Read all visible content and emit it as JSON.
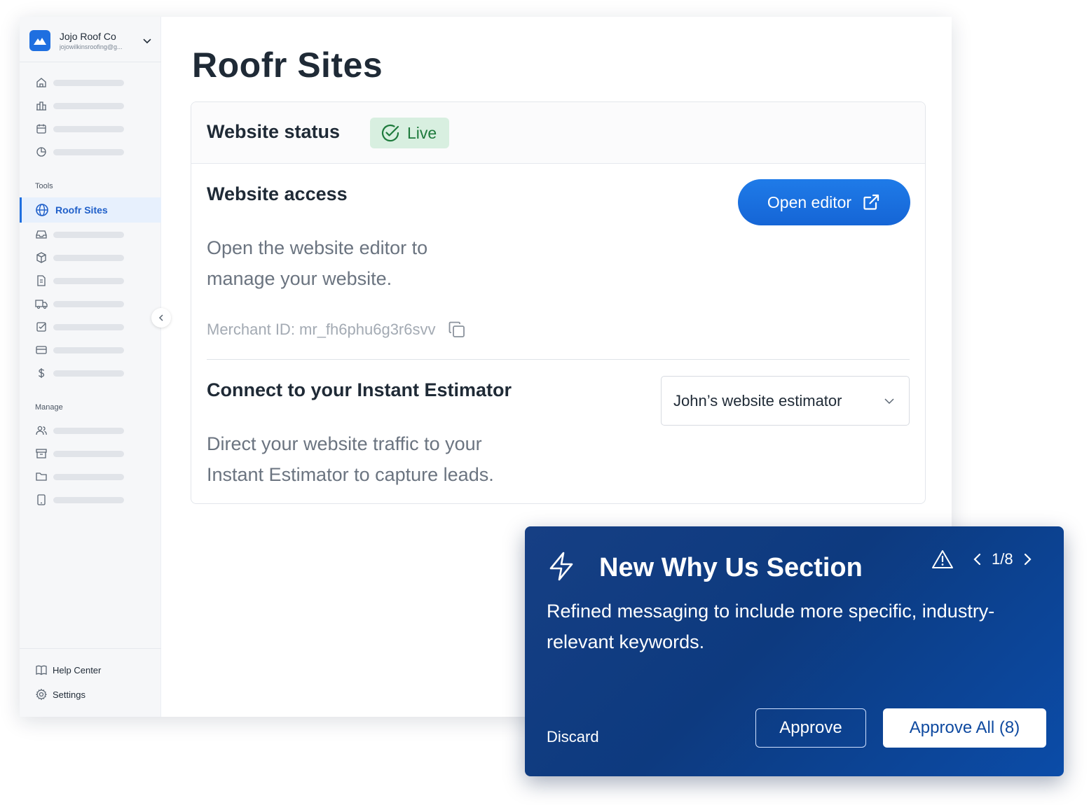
{
  "account": {
    "name": "Jojo Roof Co",
    "email": "jojowilkinsroofing@g..."
  },
  "sidebar": {
    "top_icons": [
      "home-icon",
      "building-icon",
      "calendar-icon",
      "pie-chart-icon"
    ],
    "tools_label": "Tools",
    "active_item": {
      "label": "Roofr Sites",
      "icon": "globe-icon"
    },
    "tool_icons": [
      "inbox-icon",
      "box-icon",
      "document-icon",
      "truck-icon",
      "checkbox-icon",
      "credit-card-icon",
      "dollar-icon"
    ],
    "manage_label": "Manage",
    "manage_icons": [
      "users-icon",
      "archive-icon",
      "folder-icon",
      "tablet-icon"
    ],
    "footer": [
      {
        "label": "Help Center",
        "icon": "book-icon"
      },
      {
        "label": "Settings",
        "icon": "gear-icon"
      }
    ]
  },
  "main": {
    "page_title": "Roofr Sites",
    "website_status": {
      "title": "Website status",
      "badge": "Live",
      "badge_color": "#1e7a3c"
    },
    "website_access": {
      "title": "Website access",
      "description": "Open the website editor to manage your website.",
      "merchant_id": "Merchant ID: mr_fh6phu6g3r6svv",
      "open_editor_label": "Open editor"
    },
    "instant_estimator": {
      "title": "Connect to your Instant Estimator",
      "description": "Direct your website traffic to your Instant Estimator to capture leads.",
      "selected_estimator": "John’s website estimator"
    }
  },
  "suggestion": {
    "title": "New Why Us Section",
    "description": "Refined messaging to include more specific, industry-relevant keywords.",
    "pager": "1/8",
    "discard_label": "Discard",
    "approve_label": "Approve",
    "approve_all_label": "Approve All (8)"
  },
  "colors": {
    "accent": "#1f6fe0",
    "panel_bg": "#0d3a7f"
  }
}
